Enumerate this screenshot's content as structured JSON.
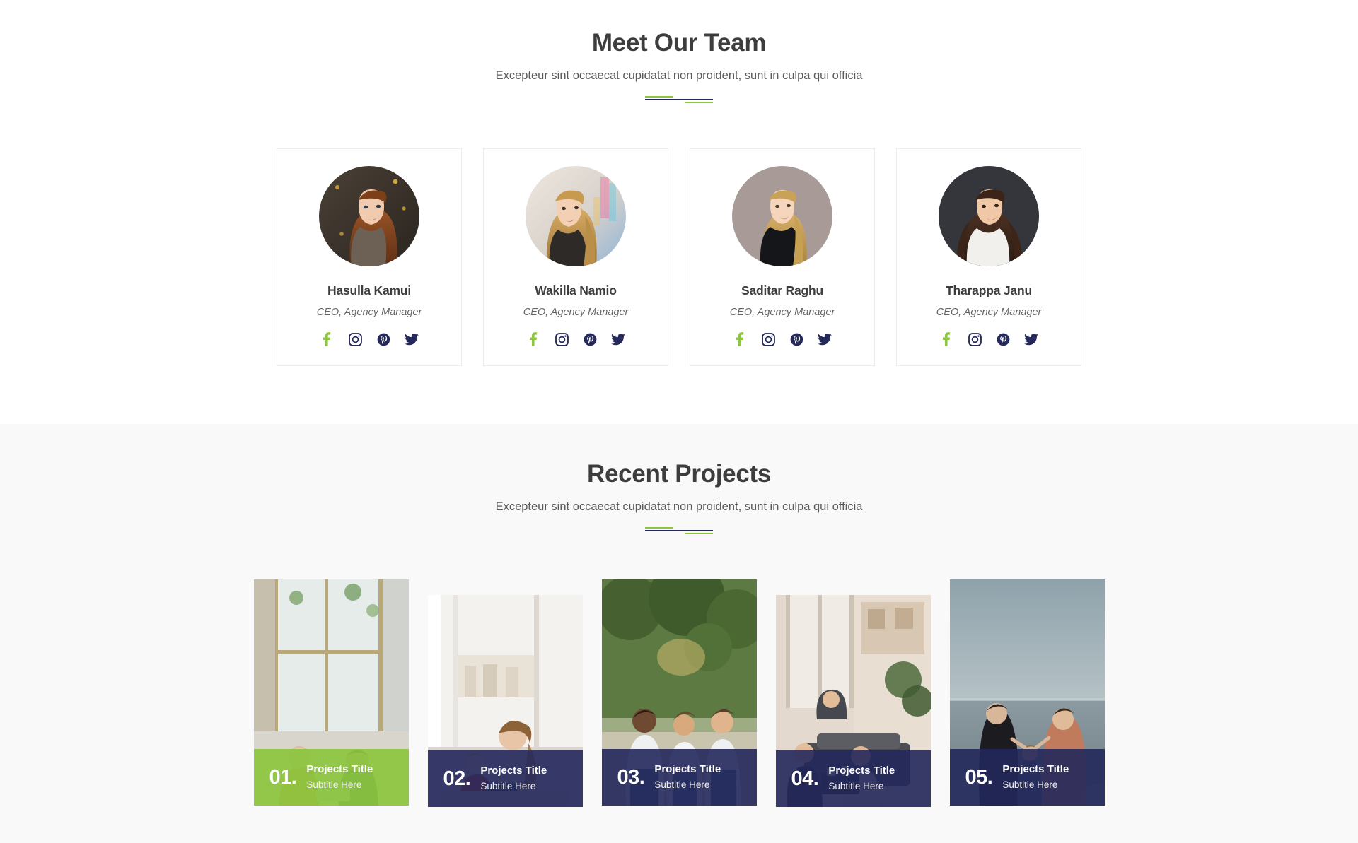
{
  "theme": {
    "accent_green": "#8cc63f",
    "accent_navy": "#24285b",
    "heading_color": "#3d3d3d",
    "page_bg": "#ffffff",
    "projects_bg": "#f9f9f9"
  },
  "team_section": {
    "title": "Meet Our Team",
    "subtitle": "Excepteur sint occaecat cupidatat non proident, sunt in culpa qui officia",
    "members": [
      {
        "name": "Hasulla Kamui",
        "role": "CEO, Agency Manager",
        "socials": [
          {
            "icon": "facebook-icon",
            "label": "Facebook",
            "color": "#8cc63f"
          },
          {
            "icon": "instagram-icon",
            "label": "Instagram",
            "color": "#24285b"
          },
          {
            "icon": "pinterest-icon",
            "label": "Pinterest",
            "color": "#24285b"
          },
          {
            "icon": "twitter-icon",
            "label": "Twitter",
            "color": "#24285b"
          }
        ]
      },
      {
        "name": "Wakilla Namio",
        "role": "CEO, Agency Manager",
        "socials": [
          {
            "icon": "facebook-icon",
            "label": "Facebook",
            "color": "#8cc63f"
          },
          {
            "icon": "instagram-icon",
            "label": "Instagram",
            "color": "#24285b"
          },
          {
            "icon": "pinterest-icon",
            "label": "Pinterest",
            "color": "#24285b"
          },
          {
            "icon": "twitter-icon",
            "label": "Twitter",
            "color": "#24285b"
          }
        ]
      },
      {
        "name": "Saditar Raghu",
        "role": "CEO, Agency Manager",
        "socials": [
          {
            "icon": "facebook-icon",
            "label": "Facebook",
            "color": "#8cc63f"
          },
          {
            "icon": "instagram-icon",
            "label": "Instagram",
            "color": "#24285b"
          },
          {
            "icon": "pinterest-icon",
            "label": "Pinterest",
            "color": "#24285b"
          },
          {
            "icon": "twitter-icon",
            "label": "Twitter",
            "color": "#24285b"
          }
        ]
      },
      {
        "name": "Tharappa Janu",
        "role": "CEO, Agency Manager",
        "socials": [
          {
            "icon": "facebook-icon",
            "label": "Facebook",
            "color": "#8cc63f"
          },
          {
            "icon": "instagram-icon",
            "label": "Instagram",
            "color": "#24285b"
          },
          {
            "icon": "pinterest-icon",
            "label": "Pinterest",
            "color": "#24285b"
          },
          {
            "icon": "twitter-icon",
            "label": "Twitter",
            "color": "#24285b"
          }
        ]
      }
    ]
  },
  "projects_section": {
    "title": "Recent Projects",
    "subtitle": "Excepteur sint occaecat cupidatat non proident, sunt in culpa qui officia",
    "projects": [
      {
        "number": "01.",
        "title": "Projects Title",
        "subtitle": "Subtitle Here",
        "overlay": "green"
      },
      {
        "number": "02.",
        "title": "Projects Title",
        "subtitle": "Subtitle Here",
        "overlay": "navy"
      },
      {
        "number": "03.",
        "title": "Projects Title",
        "subtitle": "Subtitle Here",
        "overlay": "navy"
      },
      {
        "number": "04.",
        "title": "Projects Title",
        "subtitle": "Subtitle Here",
        "overlay": "navy"
      },
      {
        "number": "05.",
        "title": "Projects Title",
        "subtitle": "Subtitle Here",
        "overlay": "navy"
      }
    ]
  }
}
